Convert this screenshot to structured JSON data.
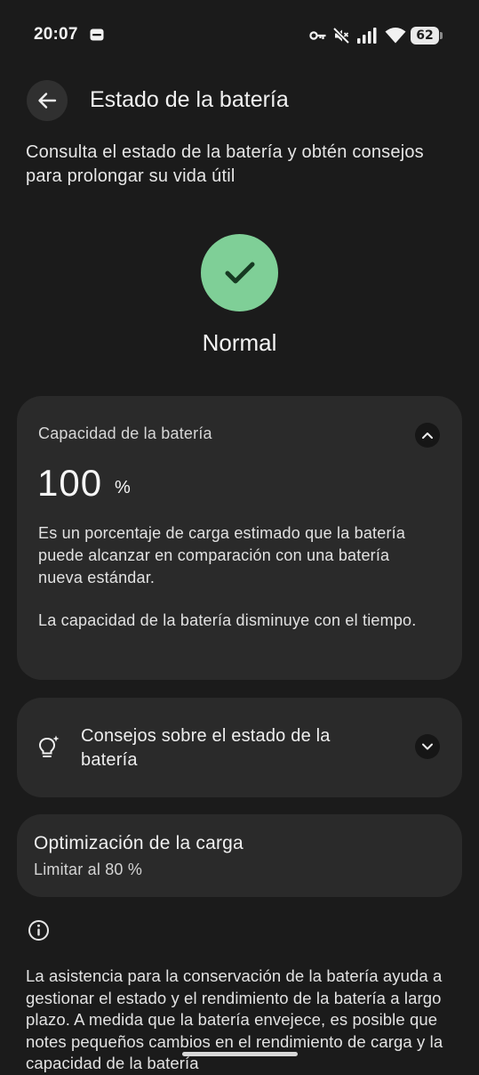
{
  "status_bar": {
    "time": "20:07",
    "battery_level": "62",
    "icons": [
      "notification-icon",
      "vpn-key-icon",
      "mute-icon",
      "signal-icon",
      "wifi-icon",
      "battery-icon"
    ]
  },
  "header": {
    "title": "Estado de la batería",
    "back_icon": "arrow-left-icon"
  },
  "subtitle": "Consulta el estado de la batería y obtén consejos para prolongar su vida útil",
  "health_status": {
    "label": "Normal",
    "icon": "check-icon",
    "color": "#7fcf97"
  },
  "capacity_card": {
    "title": "Capacidad de la batería",
    "value": "100",
    "unit": "%",
    "description": "Es un porcentaje de carga estimado que la batería puede alcanzar en comparación con una batería nueva estándar.",
    "note": "La capacidad de la batería disminuye con el tiempo.",
    "expanded": true
  },
  "tips_card": {
    "label": "Consejos sobre el estado de la batería",
    "icon": "lightbulb-sparkle-icon",
    "expanded": false
  },
  "charging_card": {
    "title": "Optimización de la carga",
    "value": "Limitar al 80 %"
  },
  "footer": {
    "icon": "info-icon",
    "text": "La asistencia para la conservación de la batería ayuda a gestionar el estado y el rendimiento de la batería a largo plazo. A medida que la batería envejece, es posible que notes pequeños cambios en el rendimiento de carga y la capacidad de la batería"
  }
}
